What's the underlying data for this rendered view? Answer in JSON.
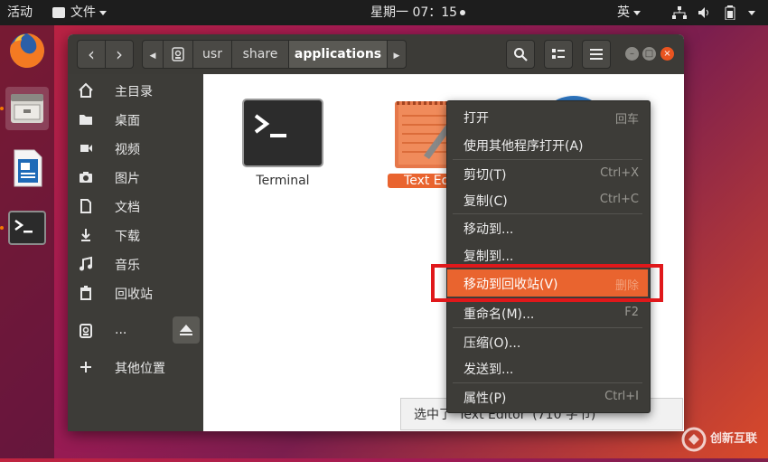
{
  "topbar": {
    "activities": "活动",
    "app_menu": "文件",
    "clock": "星期一 07：15",
    "input_method": "英"
  },
  "window": {
    "nav": {
      "back": "‹",
      "forward": "›"
    },
    "breadcrumbs": [
      "usr",
      "share",
      "applications"
    ],
    "window_controls": [
      "–",
      "□",
      "×"
    ]
  },
  "sidebar": {
    "items": [
      {
        "label": "主目录",
        "icon": "home-icon"
      },
      {
        "label": "桌面",
        "icon": "folder-icon"
      },
      {
        "label": "视频",
        "icon": "video-icon"
      },
      {
        "label": "图片",
        "icon": "camera-icon"
      },
      {
        "label": "文档",
        "icon": "document-icon"
      },
      {
        "label": "下载",
        "icon": "download-icon"
      },
      {
        "label": "音乐",
        "icon": "music-icon"
      },
      {
        "label": "回收站",
        "icon": "trash-icon"
      },
      {
        "label": "...",
        "icon": "drive-icon"
      },
      {
        "label": "其他位置",
        "icon": "plus-icon"
      }
    ]
  },
  "files": [
    {
      "name": "Terminal"
    },
    {
      "name": "Text Edit"
    }
  ],
  "status": {
    "text": "选中了“Text Editor”(710 字节)"
  },
  "context_menu": {
    "items": [
      {
        "label": "打开",
        "accel": "回车"
      },
      {
        "label": "使用其他程序打开(A)",
        "accel": ""
      },
      {
        "label": "剪切(T)",
        "accel": "Ctrl+X"
      },
      {
        "label": "复制(C)",
        "accel": "Ctrl+C"
      },
      {
        "label": "移动到...",
        "accel": ""
      },
      {
        "label": "复制到...",
        "accel": ""
      },
      {
        "label": "移动到回收站(V)",
        "accel": "删除"
      },
      {
        "label": "重命名(M)...",
        "accel": "F2"
      },
      {
        "label": "压缩(O)...",
        "accel": ""
      },
      {
        "label": "发送到...",
        "accel": ""
      },
      {
        "label": "属性(P)",
        "accel": "Ctrl+I"
      }
    ]
  },
  "watermark": {
    "text": "创新互联"
  },
  "colors": {
    "accent": "#e9642f",
    "highlight_box": "#e0181b"
  }
}
